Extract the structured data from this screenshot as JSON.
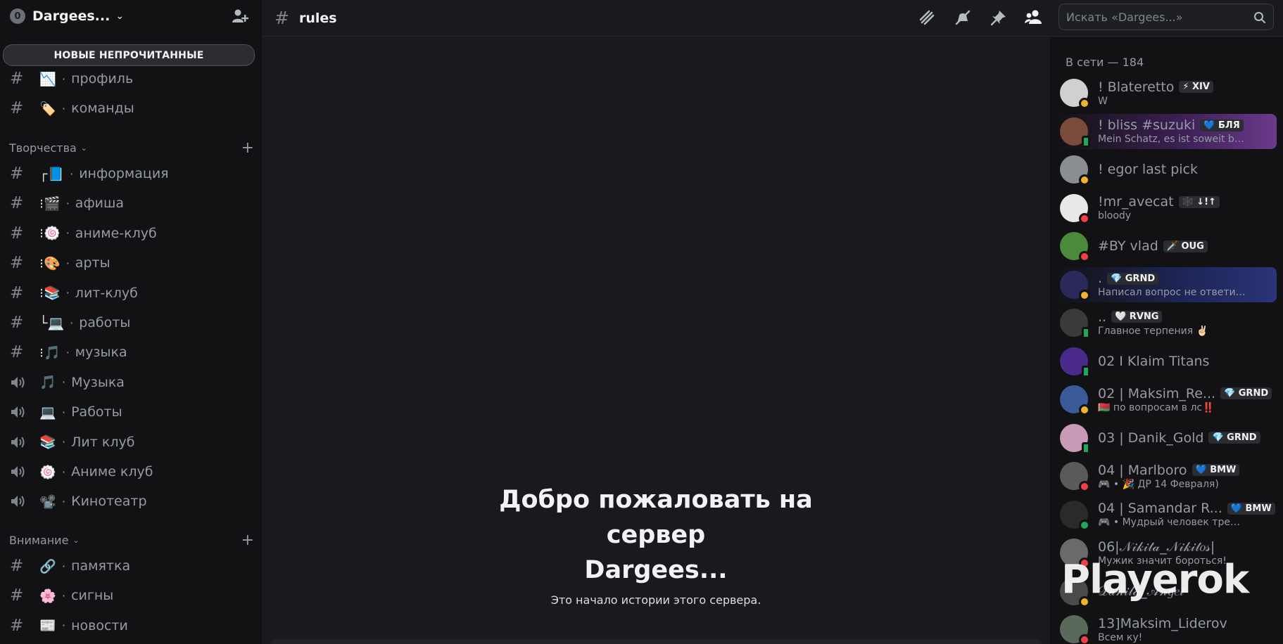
{
  "server": {
    "name": "Dargees...",
    "icon_letter": "0"
  },
  "unread_banner": "НОВЫЕ НЕПРОЧИТАННЫЕ",
  "channels_top": [
    {
      "emoji": "📉",
      "label": "профиль",
      "type": "text"
    },
    {
      "emoji": "🏷️",
      "label": "команды",
      "type": "text"
    }
  ],
  "categories": {
    "creativity": "Творчества",
    "attention": "Внимание"
  },
  "channels_creativity": [
    {
      "emoji": "┌📘",
      "label": "информация",
      "type": "text"
    },
    {
      "emoji": "⁝🎬",
      "label": "афиша",
      "type": "text"
    },
    {
      "emoji": "⁝🍥",
      "label": "аниме-клуб",
      "type": "text"
    },
    {
      "emoji": "⁝🎨",
      "label": "арты",
      "type": "text"
    },
    {
      "emoji": "⁝📚",
      "label": "лит-клуб",
      "type": "text"
    },
    {
      "emoji": "└💻",
      "label": "работы",
      "type": "text"
    },
    {
      "emoji": "⁝🎵",
      "label": "музыка",
      "type": "text"
    },
    {
      "emoji": "🎵",
      "label": "Музыка",
      "type": "voice"
    },
    {
      "emoji": "💻",
      "label": "Работы",
      "type": "voice"
    },
    {
      "emoji": "📚",
      "label": "Лит клуб",
      "type": "voice"
    },
    {
      "emoji": "🍥",
      "label": "Аниме клуб",
      "type": "voice"
    },
    {
      "emoji": "📽️",
      "label": "Кинотеатр",
      "type": "voice"
    }
  ],
  "channels_attention": [
    {
      "emoji": "🔗",
      "label": "памятка",
      "type": "text"
    },
    {
      "emoji": "🌸",
      "label": "сигны",
      "type": "text"
    },
    {
      "emoji": "📰",
      "label": "новости",
      "type": "text"
    }
  ],
  "separator_dot": "·",
  "topbar": {
    "channel": "rules",
    "search_placeholder": "Искать «Dargees...»"
  },
  "welcome": {
    "title_line1": "Добро пожаловать на",
    "title_line2": "сервер",
    "title_line3": "Dargees...",
    "subtitle": "Это начало истории этого сервера."
  },
  "members_header": "В сети — 184",
  "members": [
    {
      "name": "! Blateretto",
      "tag": "⚡ XIV",
      "sub": "W",
      "status": "idle",
      "avatar": "#d0d0d0"
    },
    {
      "name": "! bliss #suzuki",
      "tag": "💙 БЛЯ",
      "sub": "Mein Schatz, es ist soweit by Bli",
      "status": "mobile",
      "avatar": "#7a4a3a",
      "highlight": "purple"
    },
    {
      "name": "! egor last pick",
      "tag": "",
      "sub": "",
      "status": "idle",
      "avatar": "#8a8d92"
    },
    {
      "name": "!mr_avecat",
      "tag": "🕸️ ↓!↑",
      "sub": "bloody",
      "status": "dnd",
      "avatar": "#e8e8e8"
    },
    {
      "name": "#BY vlad",
      "tag": "🗡️ OUG",
      "sub": "",
      "status": "dnd",
      "avatar": "#4a8a3a"
    },
    {
      "name": ".",
      "tag": "💎 GRND",
      "sub": "Написал вопрос не ответил зна",
      "status": "idle",
      "avatar": "#2a2a5a",
      "highlight": "blue"
    },
    {
      "name": "..",
      "tag": "🤍 RVNG",
      "sub": "Главное терпения ✌🏻",
      "status": "mobile",
      "avatar": "#3a3a3a"
    },
    {
      "name": "02 I Klaim Titans",
      "tag": "",
      "sub": "",
      "status": "mobile",
      "avatar": "#4a2a8a"
    },
    {
      "name": "02 | Maksim_Re...",
      "tag": "💎 GRND",
      "sub": "🇧🇾 по вопросам в лс‼️",
      "status": "idle",
      "avatar": "#3a5a9a"
    },
    {
      "name": "03 | Danik_Gold",
      "tag": "💎 GRND",
      "sub": "",
      "status": "mobile",
      "avatar": "#c89ab8"
    },
    {
      "name": "04 | Marlboro",
      "tag": "💙 BMW",
      "sub": "🎮 • 🎉 ДР 14 Февраля)",
      "status": "dnd",
      "avatar": "#5a5a5a"
    },
    {
      "name": "04 | Samandar R...",
      "tag": "💙 BMW",
      "sub": "🎮 • Мудрый человек требует всегд",
      "status": "online",
      "avatar": "#2a2a2a"
    },
    {
      "name": "06|𝒩𝒾𝓀𝒾𝓉𝒶_𝒩𝒾𝓀𝒾𝓉𝑜𝓈|",
      "tag": "",
      "sub": "Мужик значит бороться!",
      "status": "dnd",
      "avatar": "#6a6a6a"
    },
    {
      "name": "𝒟𝒶𝓃𝒾𝓁𝒶_𝒜𝓃𝑔𝑒𝓁",
      "tag": "",
      "sub": "",
      "status": "idle",
      "avatar": "#4a4a4a"
    },
    {
      "name": "13]Maksim_Liderov",
      "tag": "",
      "sub": "Всем ку!",
      "status": "dnd",
      "avatar": "#5a6a5a"
    }
  ],
  "watermark": "Playerok",
  "colors": {
    "sidebar_bg": "#121214",
    "main_bg": "#1a1a1e",
    "idle": "#f0b232",
    "dnd": "#f23f43",
    "online": "#23a55a"
  },
  "icons": [
    "invite-user-icon",
    "threads-icon",
    "mute-icon",
    "pin-icon",
    "member-list-icon",
    "search-icon",
    "speaker-icon"
  ]
}
